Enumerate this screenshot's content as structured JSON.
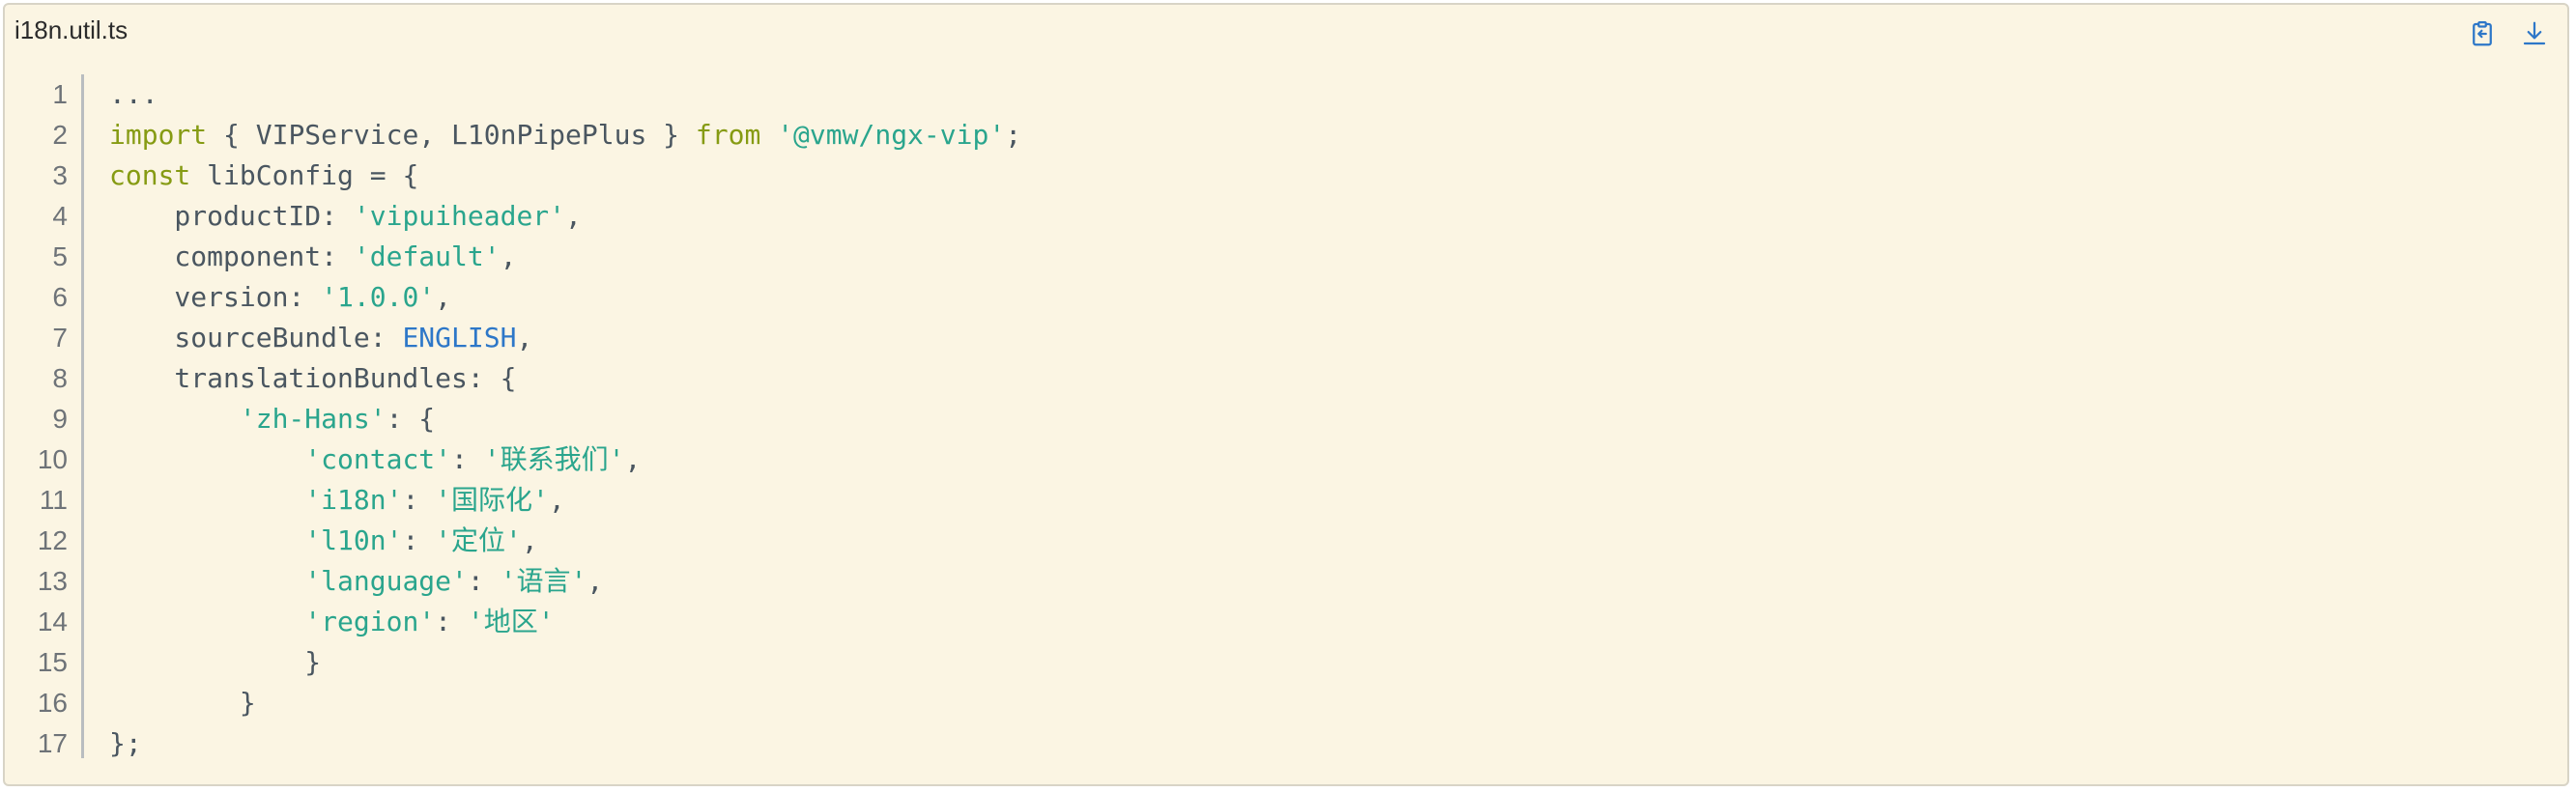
{
  "file": {
    "name": "i18n.util.ts"
  },
  "toolbar": {
    "copy_icon": "clipboard-icon",
    "download_icon": "download-icon"
  },
  "colors": {
    "background": "#fbf5e3",
    "keyword": "#869b13",
    "string": "#2aa58d",
    "constant": "#2d77c8",
    "text": "#4a5660",
    "line_number": "#6e7378"
  },
  "code": {
    "lines": [
      {
        "number": "1",
        "segments": [
          {
            "t": "...",
            "c": "plain"
          }
        ]
      },
      {
        "number": "2",
        "segments": [
          {
            "t": "import",
            "c": "kw"
          },
          {
            "t": " { VIPService, L10nPipePlus } ",
            "c": "plain"
          },
          {
            "t": "from",
            "c": "kw"
          },
          {
            "t": " ",
            "c": "plain"
          },
          {
            "t": "'@vmw/ngx-vip'",
            "c": "str"
          },
          {
            "t": ";",
            "c": "plain"
          }
        ]
      },
      {
        "number": "3",
        "segments": [
          {
            "t": "const",
            "c": "kw"
          },
          {
            "t": " libConfig = {",
            "c": "plain"
          }
        ]
      },
      {
        "number": "4",
        "segments": [
          {
            "t": "    productID: ",
            "c": "plain"
          },
          {
            "t": "'vipuiheader'",
            "c": "str"
          },
          {
            "t": ",",
            "c": "plain"
          }
        ]
      },
      {
        "number": "5",
        "segments": [
          {
            "t": "    component: ",
            "c": "plain"
          },
          {
            "t": "'default'",
            "c": "str"
          },
          {
            "t": ",",
            "c": "plain"
          }
        ]
      },
      {
        "number": "6",
        "segments": [
          {
            "t": "    version: ",
            "c": "plain"
          },
          {
            "t": "'1.0.0'",
            "c": "str"
          },
          {
            "t": ",",
            "c": "plain"
          }
        ]
      },
      {
        "number": "7",
        "segments": [
          {
            "t": "    sourceBundle: ",
            "c": "plain"
          },
          {
            "t": "ENGLISH",
            "c": "const"
          },
          {
            "t": ",",
            "c": "plain"
          }
        ]
      },
      {
        "number": "8",
        "segments": [
          {
            "t": "    translationBundles: {",
            "c": "plain"
          }
        ]
      },
      {
        "number": "9",
        "segments": [
          {
            "t": "        ",
            "c": "plain"
          },
          {
            "t": "'zh-Hans'",
            "c": "str"
          },
          {
            "t": ": {",
            "c": "plain"
          }
        ]
      },
      {
        "number": "10",
        "segments": [
          {
            "t": "            ",
            "c": "plain"
          },
          {
            "t": "'contact'",
            "c": "str"
          },
          {
            "t": ": ",
            "c": "plain"
          },
          {
            "t": "'联系我们'",
            "c": "str"
          },
          {
            "t": ",",
            "c": "plain"
          }
        ]
      },
      {
        "number": "11",
        "segments": [
          {
            "t": "            ",
            "c": "plain"
          },
          {
            "t": "'i18n'",
            "c": "str"
          },
          {
            "t": ": ",
            "c": "plain"
          },
          {
            "t": "'国际化'",
            "c": "str"
          },
          {
            "t": ",",
            "c": "plain"
          }
        ]
      },
      {
        "number": "12",
        "segments": [
          {
            "t": "            ",
            "c": "plain"
          },
          {
            "t": "'l10n'",
            "c": "str"
          },
          {
            "t": ": ",
            "c": "plain"
          },
          {
            "t": "'定位'",
            "c": "str"
          },
          {
            "t": ",",
            "c": "plain"
          }
        ]
      },
      {
        "number": "13",
        "segments": [
          {
            "t": "            ",
            "c": "plain"
          },
          {
            "t": "'language'",
            "c": "str"
          },
          {
            "t": ": ",
            "c": "plain"
          },
          {
            "t": "'语言'",
            "c": "str"
          },
          {
            "t": ",",
            "c": "plain"
          }
        ]
      },
      {
        "number": "14",
        "segments": [
          {
            "t": "            ",
            "c": "plain"
          },
          {
            "t": "'region'",
            "c": "str"
          },
          {
            "t": ": ",
            "c": "plain"
          },
          {
            "t": "'地区'",
            "c": "str"
          }
        ]
      },
      {
        "number": "15",
        "segments": [
          {
            "t": "            }",
            "c": "plain"
          }
        ]
      },
      {
        "number": "16",
        "segments": [
          {
            "t": "        }",
            "c": "plain"
          }
        ]
      },
      {
        "number": "17",
        "segments": [
          {
            "t": "};",
            "c": "plain"
          }
        ]
      }
    ]
  }
}
